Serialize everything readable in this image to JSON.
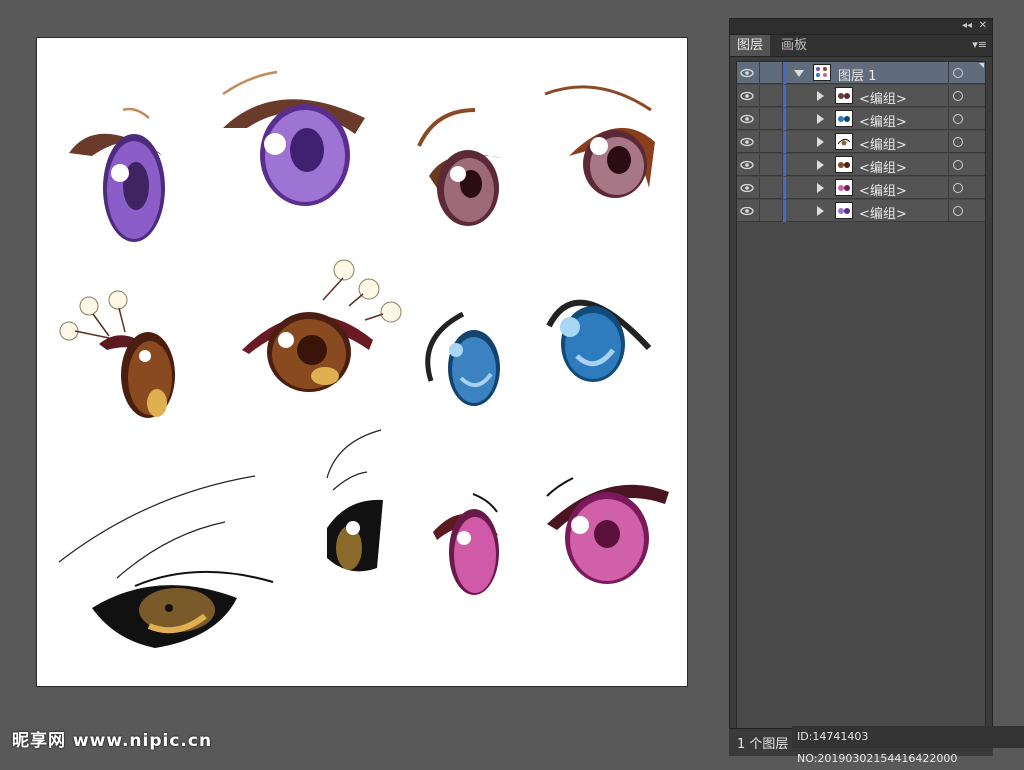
{
  "panel": {
    "collapse_glyph": "◂◂",
    "close_glyph": "✕",
    "tabs": [
      {
        "label": "图层",
        "active": true
      },
      {
        "label": "画板",
        "active": false
      }
    ],
    "menu_glyph": "▾≡",
    "layers": [
      {
        "name": "图层 1",
        "expanded": true
      },
      {
        "name": "<编组>"
      },
      {
        "name": "<编组>"
      },
      {
        "name": "<编组>"
      },
      {
        "name": "<编组>"
      },
      {
        "name": "<编组>"
      },
      {
        "name": "<编组>"
      }
    ],
    "status_count": "1 个图层"
  },
  "watermark": {
    "logo_text": "昵享网 www.nipic.cn",
    "id_text": "ID:14741403 NO:20190302154416422000"
  },
  "colors": {
    "canvas_bg": "#595959",
    "artboard": "#ffffff",
    "selection_bar": "#3f6bd3",
    "selected_row": "#606b7c"
  }
}
